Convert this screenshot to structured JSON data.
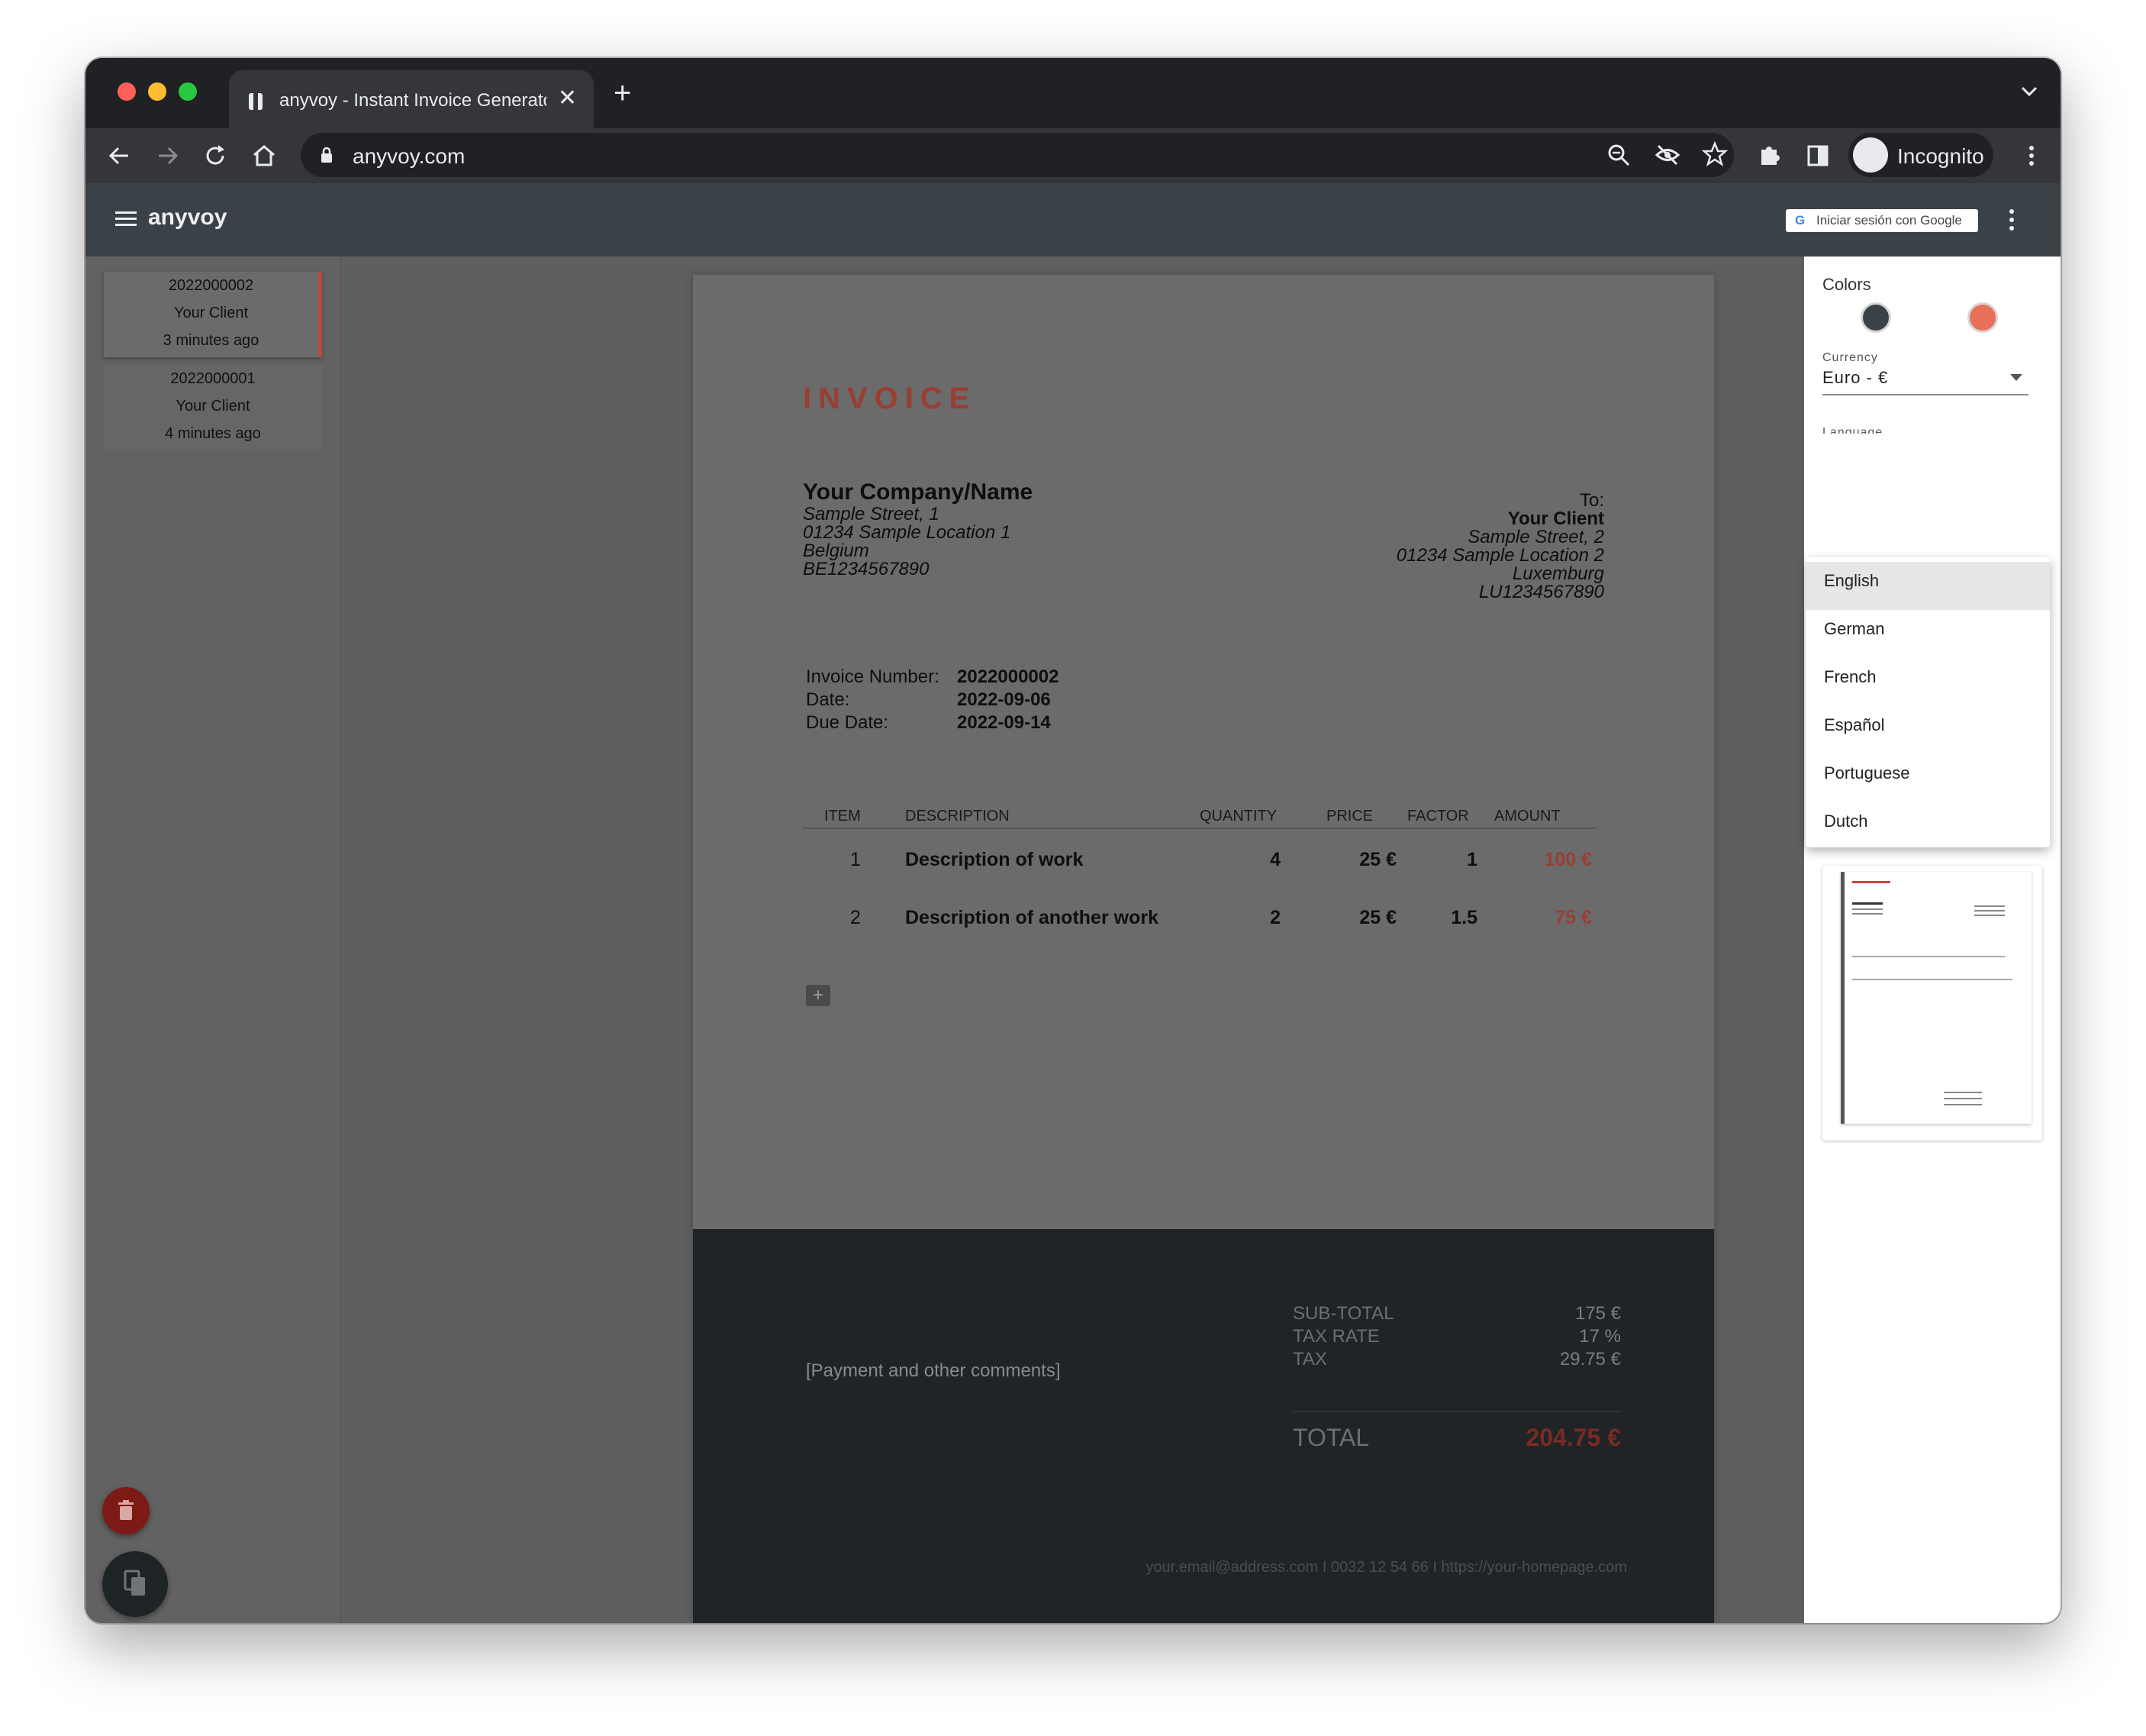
{
  "browser": {
    "tab_title": "anyvoy - Instant Invoice Generator",
    "tab_close": "✕",
    "new_tab": "+",
    "url": "anyvoy.com",
    "profile_label": "Incognito"
  },
  "app": {
    "brand": "anyvoy",
    "signin_label": "Iniciar sesión con Google",
    "signin_logo": "G"
  },
  "sidebar": {
    "invoices": [
      {
        "number": "2022000002",
        "client": "Your Client",
        "time": "3 minutes ago"
      },
      {
        "number": "2022000001",
        "client": "Your Client",
        "time": "4 minutes ago"
      }
    ]
  },
  "invoice": {
    "title": "INVOICE",
    "sender": {
      "name": "Your Company/Name",
      "lines": [
        "Sample Street, 1",
        "01234 Sample Location 1",
        "Belgium",
        "BE1234567890"
      ]
    },
    "recipient": {
      "to_label": "To:",
      "name": "Your Client",
      "lines": [
        "Sample Street, 2",
        "01234 Sample Location 2",
        "Luxemburg",
        "LU1234567890"
      ]
    },
    "meta": {
      "number_label": "Invoice Number:",
      "number": "2022000002",
      "date_label": "Date:",
      "date": "2022-09-06",
      "due_label": "Due Date:",
      "due": "2022-09-14"
    },
    "columns": {
      "item": "ITEM",
      "description": "DESCRIPTION",
      "quantity": "QUANTITY",
      "price": "PRICE",
      "factor": "FACTOR",
      "amount": "AMOUNT"
    },
    "rows": [
      {
        "item": "1",
        "description": "Description of work",
        "quantity": "4",
        "price": "25 €",
        "factor": "1",
        "amount": "100 €"
      },
      {
        "item": "2",
        "description": "Description of another work",
        "quantity": "2",
        "price": "25 €",
        "factor": "1.5",
        "amount": "75 €"
      }
    ],
    "add_row_label": "+",
    "comments": "[Payment and other comments]",
    "totals": {
      "subtotal_label": "SUB-TOTAL",
      "subtotal": "175 €",
      "taxrate_label": "TAX RATE",
      "taxrate": "17 %",
      "tax_label": "TAX",
      "tax": "29.75 €",
      "total_label": "TOTAL",
      "total": "204.75 €"
    },
    "contact": "your.email@address.com  I  0032 12 54 66  I  https://your-homepage.com"
  },
  "settings": {
    "colors_label": "Colors",
    "color_primary": "#3a4248",
    "color_accent": "#e8705a",
    "currency_label": "Currency",
    "currency_value": "Euro - €",
    "language_label": "Language",
    "language_options": [
      "English",
      "German",
      "French",
      "Español",
      "Portuguese",
      "Dutch"
    ],
    "language_selected": "English"
  },
  "colors": {
    "invoice_accent": "#9a3e33",
    "app_bar": "#3a4248",
    "delete_fab": "#7c1b15"
  }
}
